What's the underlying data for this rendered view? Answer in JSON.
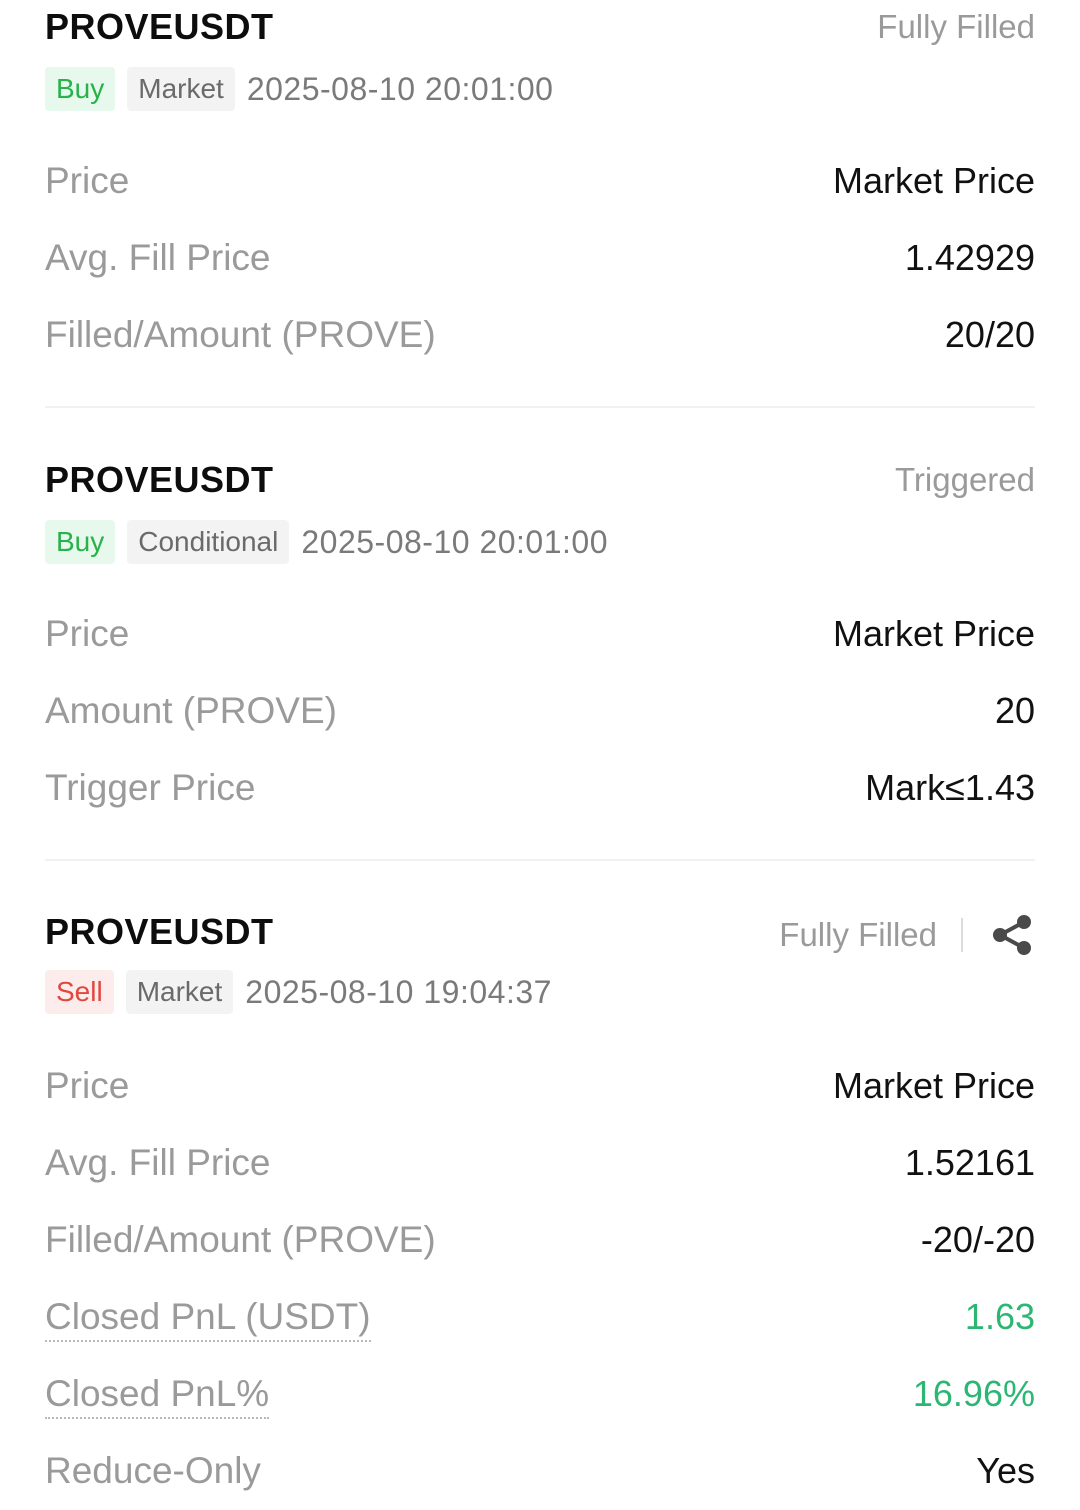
{
  "colors": {
    "buy_green": "#27b24a",
    "sell_red": "#e2463d",
    "pnl_green": "#2bb673",
    "muted_gray": "#9a9a9a"
  },
  "orders": [
    {
      "symbol": "PROVEUSDT",
      "status": "Fully Filled",
      "side": "Buy",
      "type": "Market",
      "datetime": "2025-08-10 20:01:00",
      "rows": [
        {
          "label": "Price",
          "value": "Market Price"
        },
        {
          "label": "Avg. Fill Price",
          "value": "1.42929"
        },
        {
          "label": "Filled/Amount (PROVE)",
          "value": "20/20"
        }
      ]
    },
    {
      "symbol": "PROVEUSDT",
      "status": "Triggered",
      "side": "Buy",
      "type": "Conditional",
      "datetime": "2025-08-10 20:01:00",
      "rows": [
        {
          "label": "Price",
          "value": "Market Price"
        },
        {
          "label": "Amount (PROVE)",
          "value": "20"
        },
        {
          "label": "Trigger Price",
          "value": "Mark≤1.43"
        }
      ]
    },
    {
      "symbol": "PROVEUSDT",
      "status": "Fully Filled",
      "share_icon": "share-icon",
      "side": "Sell",
      "type": "Market",
      "datetime": "2025-08-10 19:04:37",
      "rows": [
        {
          "label": "Price",
          "value": "Market Price"
        },
        {
          "label": "Avg. Fill Price",
          "value": "1.52161"
        },
        {
          "label": "Filled/Amount (PROVE)",
          "value": "-20/-20"
        },
        {
          "label": "Closed PnL (USDT)",
          "value": "1.63"
        },
        {
          "label": "Closed PnL%",
          "value": "16.96%"
        },
        {
          "label": "Reduce-Only",
          "value": "Yes"
        }
      ]
    }
  ]
}
